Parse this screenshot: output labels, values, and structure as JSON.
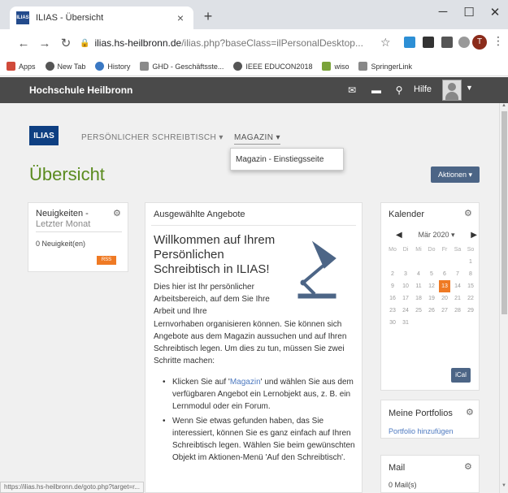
{
  "browser": {
    "tab_title": "ILIAS - Übersicht",
    "favicon_text": "ILIAS",
    "tab_close": "×",
    "new_tab": "+",
    "url_host": "ilias.hs-heilbronn.de",
    "url_path": "/ilias.php?baseClass=ilPersonalDesktop...",
    "profile_initial": "T",
    "bookmarks": [
      {
        "label": "Apps",
        "color": "#d04a3a"
      },
      {
        "label": "New Tab",
        "color": "#555555"
      },
      {
        "label": "History",
        "color": "#3a78c3"
      },
      {
        "label": "GHD - Geschäftsste...",
        "color": "#8a8a8a"
      },
      {
        "label": "IEEE EDUCON2018",
        "color": "#555555"
      },
      {
        "label": "wiso",
        "color": "#7aa33a"
      },
      {
        "label": "SpringerLink",
        "color": "#888888"
      }
    ],
    "status_url": "https://ilias.hs-heilbronn.de/goto.php?target=r..."
  },
  "topbar": {
    "brand": "Hochschule Heilbronn",
    "help": "Hilfe"
  },
  "nav": {
    "logo": "ILIAS",
    "items": [
      {
        "label": "PERSÖNLICHER SCHREIBTISCH ▾"
      },
      {
        "label": "MAGAZIN ▾"
      }
    ],
    "dropdown_item": "Magazin - Einstiegsseite"
  },
  "page": {
    "title": "Übersicht",
    "actions_label": "Aktionen ▾"
  },
  "news": {
    "title_line1": "Neuigkeiten -",
    "title_line2": "Letzter Monat",
    "count": "0 Neuigkeit(en)",
    "rss": "RSS"
  },
  "featured": {
    "title": "Ausgewählte Angebote",
    "welcome": "Willkommen auf Ihrem Persönlichen Schreibtisch in ILIAS!",
    "intro_short": "Dies hier ist Ihr persönlicher Arbeitsbereich, auf dem Sie Ihre Arbeit und Ihre",
    "intro_long": "Lernvorhaben organisieren können. Sie können sich Angebote aus dem Magazin aussuchen und auf Ihren Schreibtisch legen. Um dies zu tun, müssen Sie zwei Schritte machen:",
    "bullet1_pre": "Klicken Sie auf '",
    "bullet1_link": "Magazin",
    "bullet1_post": "' und wählen Sie aus dem verfügbaren Angebot ein Lernobjekt aus, z. B. ein Lernmodul oder ein Forum.",
    "bullet2": "Wenn Sie etwas gefunden haben, das Sie interessiert, können Sie es ganz einfach auf Ihren Schreibtisch legen. Wählen Sie beim gewünschten Objekt im Aktionen-Menü 'Auf den Schreibtisch'."
  },
  "calendar": {
    "title": "Kalender",
    "month": "Mär 2020 ▾",
    "weekdays": [
      "Mo",
      "Di",
      "Mi",
      "Do",
      "Fr",
      "Sa",
      "So"
    ],
    "weeks": [
      [
        "",
        "",
        "",
        "",
        "",
        "",
        "1"
      ],
      [
        "2",
        "3",
        "4",
        "5",
        "6",
        "7",
        "8"
      ],
      [
        "9",
        "10",
        "11",
        "12",
        "13",
        "14",
        "15"
      ],
      [
        "16",
        "17",
        "18",
        "19",
        "20",
        "21",
        "22"
      ],
      [
        "23",
        "24",
        "25",
        "26",
        "27",
        "28",
        "29"
      ],
      [
        "30",
        "31",
        "",
        "",
        "",
        "",
        ""
      ]
    ],
    "today": "13",
    "ical": "iCal"
  },
  "portfolio": {
    "title": "Meine Portfolios",
    "add": "Portfolio hinzufügen"
  },
  "mail": {
    "title": "Mail",
    "count": "0 Mail(s)"
  }
}
